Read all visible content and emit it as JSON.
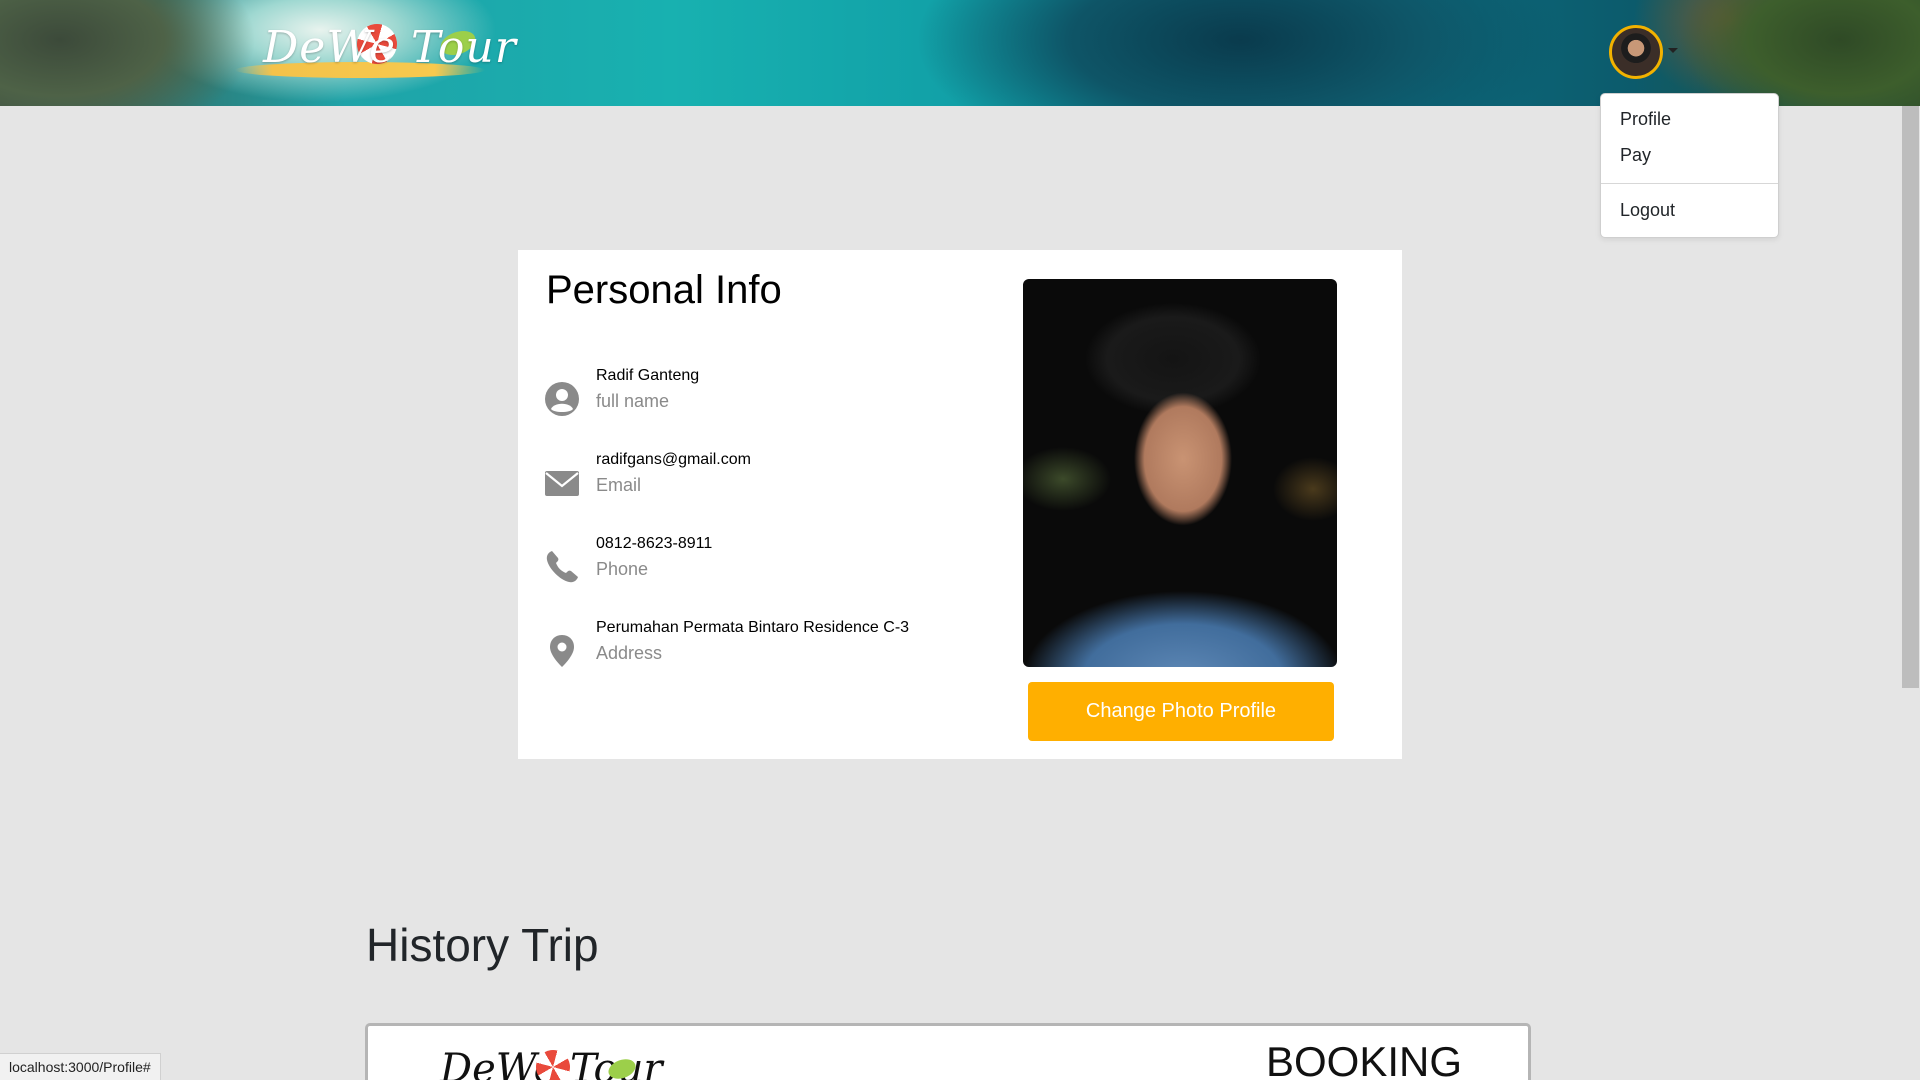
{
  "header": {
    "logo_text": "DeWe Tour",
    "logo_alt": "DeWe Tour logo",
    "avatar_alt": "user avatar"
  },
  "dropdown": {
    "items": [
      "Profile",
      "Pay"
    ],
    "logout": "Logout"
  },
  "personal_info": {
    "title": "Personal Info",
    "rows": [
      {
        "value": "Radif Ganteng",
        "label": "full name",
        "icon": "user-circle-icon"
      },
      {
        "value": "radifgans@gmail.com",
        "label": "Email",
        "icon": "envelope-icon"
      },
      {
        "value": "0812-8623-8911",
        "label": "Phone",
        "icon": "phone-icon"
      },
      {
        "value": "Perumahan Permata Bintaro Residence C-3",
        "label": "Address",
        "icon": "map-pin-icon"
      }
    ],
    "change_photo_label": "Change Photo Profile"
  },
  "history": {
    "title": "History Trip",
    "booking_label": "BOOKING"
  },
  "status_bar": {
    "url": "localhost:3000/Profile#"
  },
  "colors": {
    "accent": "#ffaf00",
    "page_bg": "#e5e5e5",
    "icon_gray": "#8a8a8a"
  }
}
